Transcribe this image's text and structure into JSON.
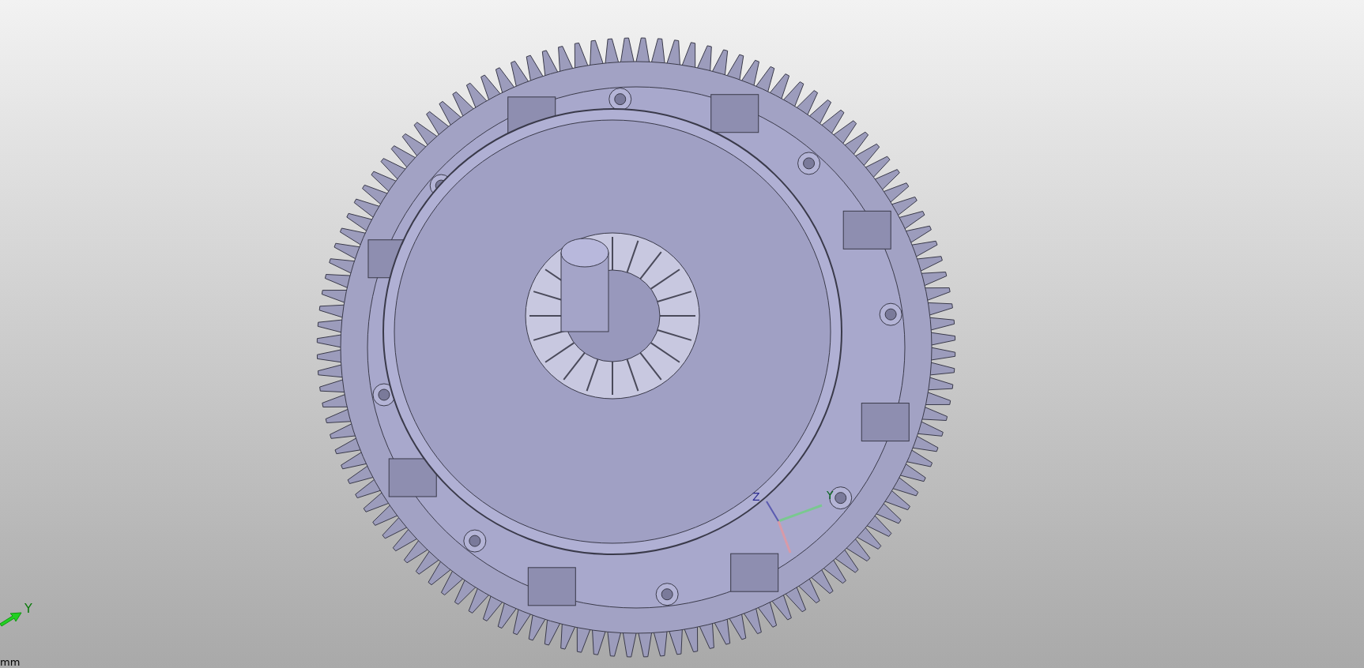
{
  "viewport": {
    "model_triad": {
      "labels": [
        "Z",
        "Y"
      ]
    },
    "view_triad": {
      "label": "Y"
    },
    "units_label": "mm"
  }
}
